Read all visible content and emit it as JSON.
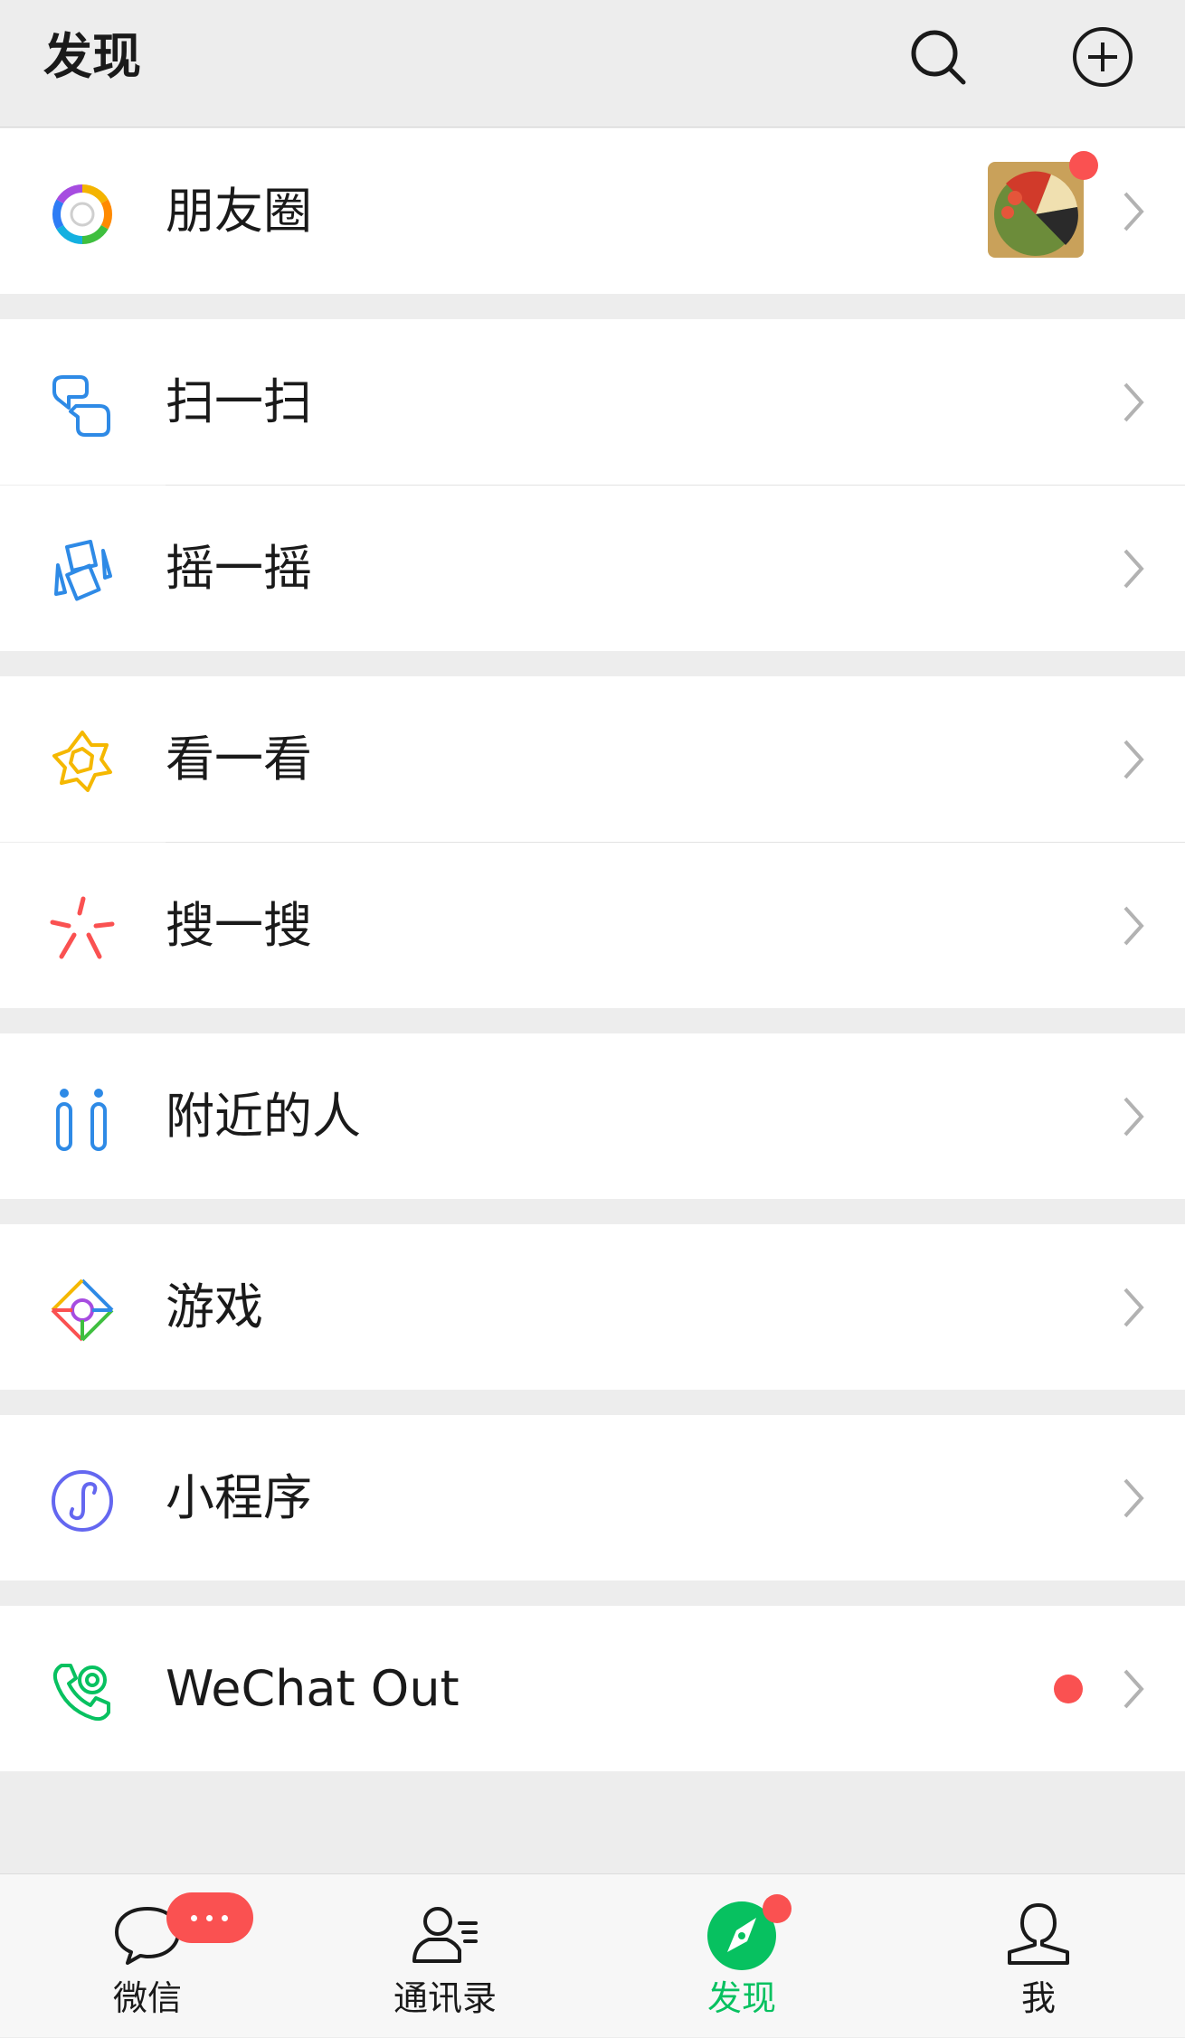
{
  "header": {
    "title": "发现",
    "search_icon": "search-icon",
    "add_icon": "plus-circle-icon"
  },
  "rows": [
    {
      "label": "朋友圈",
      "icon": "moments-icon"
    },
    {
      "label": "扫一扫",
      "icon": "scan-icon"
    },
    {
      "label": "摇一摇",
      "icon": "shake-icon"
    },
    {
      "label": "看一看",
      "icon": "top-stories-icon"
    },
    {
      "label": "搜一搜",
      "icon": "search-spark-icon"
    },
    {
      "label": "附近的人",
      "icon": "people-nearby-icon"
    },
    {
      "label": "游戏",
      "icon": "games-icon"
    },
    {
      "label": "小程序",
      "icon": "mini-programs-icon"
    },
    {
      "label": "WeChat Out",
      "icon": "wechat-out-icon"
    }
  ],
  "tabs": [
    {
      "label": "微信",
      "icon": "chat-icon"
    },
    {
      "label": "通讯录",
      "icon": "contacts-icon"
    },
    {
      "label": "发现",
      "icon": "discover-icon",
      "active": true
    },
    {
      "label": "我",
      "icon": "me-icon"
    }
  ],
  "colors": {
    "accent": "#07c160",
    "badge": "#fa5151",
    "background": "#ededed"
  }
}
